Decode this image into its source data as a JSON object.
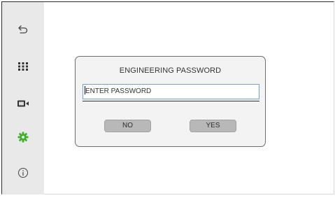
{
  "sidebar": {
    "items": [
      {
        "icon": "back-arrow-icon"
      },
      {
        "icon": "grid-menu-icon"
      },
      {
        "icon": "video-camera-icon"
      },
      {
        "icon": "gear-icon",
        "color": "#3fae29"
      },
      {
        "icon": "info-icon"
      }
    ]
  },
  "dialog": {
    "title": "ENGINEERING PASSWORD",
    "password_placeholder": "ENTER PASSWORD",
    "no_label": "NO",
    "yes_label": "YES"
  },
  "colors": {
    "sidebar_bg": "#e9e9e9",
    "accent_green": "#3fae29",
    "field_border": "#6f9fd9",
    "button_bg": "#b8b8b8"
  }
}
